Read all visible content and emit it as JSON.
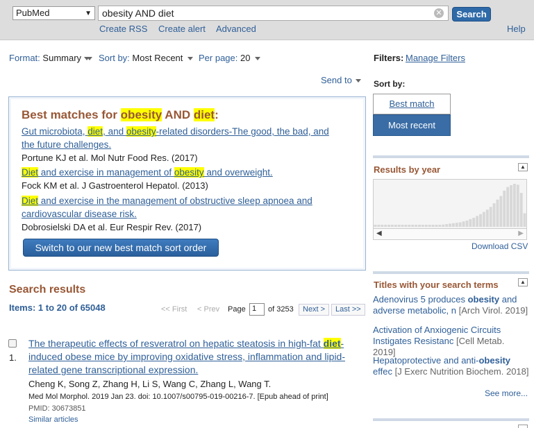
{
  "search": {
    "database": "PubMed",
    "query": "obesity AND diet",
    "button": "Search",
    "links": [
      "Create RSS",
      "Create alert",
      "Advanced"
    ],
    "help": "Help"
  },
  "toolbar": {
    "format_label": "Format:",
    "format_value": "Summary",
    "sort_label": "Sort by:",
    "sort_value": "Most Recent",
    "perpage_label": "Per page:",
    "perpage_value": "20",
    "send_to": "Send to"
  },
  "best": {
    "heading": [
      "Best matches for ",
      "obesity",
      " AND ",
      "diet",
      ":"
    ],
    "items": [
      {
        "line1": [
          "Gut microbiota, ",
          "diet",
          ", and ",
          "obesity",
          "-related disorders-The good, the bad, and"
        ],
        "line2": "the future challenges.",
        "cite": "Portune KJ et al. Mol Nutr Food Res. (2017)"
      },
      {
        "line1": [
          "Diet",
          " and exercise in management of ",
          "obesity",
          " and overweight."
        ],
        "cite": "Fock KM et al. J Gastroenterol Hepatol. (2013)"
      },
      {
        "line1": [
          "Diet",
          " and exercise in the management of obstructive sleep apnoea and"
        ],
        "line2": "cardiovascular disease risk.",
        "cite": "Dobrosielski DA et al. Eur Respir Rev. (2017)"
      }
    ],
    "switch_button": "Switch to our new best match sort order"
  },
  "results": {
    "heading": "Search results",
    "items_label": "Items: 1 to 20 of 65048",
    "first": "<< First",
    "prev": "< Prev",
    "page_label": "Page",
    "page_value": "1",
    "page_of": "of 3253",
    "next": "Next >",
    "last": "Last >>",
    "list": [
      {
        "num": "1.",
        "title1": [
          "The therapeutic effects of resveratrol on hepatic steatosis in high-fat ",
          "diet",
          "-"
        ],
        "title2": "induced obese mice by improving oxidative stress, inflammation and lipid-",
        "title3": "related gene transcriptional expression.",
        "authors": "Cheng K, Song Z, Zhang H, Li S, Wang C, Zhang L, Wang T.",
        "journal": "Med Mol Morphol. 2019 Jan 23. doi: 10.1007/s00795-019-00216-7. [Epub ahead of print]",
        "pmid": "PMID: 30673851",
        "similar": "Similar articles"
      }
    ]
  },
  "sidebar": {
    "filters_label": "Filters:",
    "manage_filters": "Manage Filters",
    "sortby_label": "Sort by:",
    "sort_options": [
      "Best match",
      "Most recent"
    ],
    "by_year": {
      "title": "Results by year",
      "counts": [
        3,
        3,
        3,
        3,
        3,
        3,
        3,
        3,
        3,
        3,
        3,
        3,
        3,
        3,
        3,
        3,
        3,
        4,
        4,
        4,
        5,
        6,
        7,
        8,
        9,
        10,
        12,
        14,
        17,
        20,
        24,
        28,
        33,
        38,
        44,
        52,
        60,
        68,
        80,
        88,
        92,
        95,
        93,
        75,
        30
      ],
      "download": "Download CSV"
    },
    "titles": {
      "header": "Titles with your search terms",
      "items": [
        {
          "text1": [
            "Adenovirus 5 produces ",
            "obesity",
            " and"
          ],
          "text2": "adverse metabolic, n",
          "source": "[Arch Virol. 2019]"
        },
        {
          "text1": [
            "Activation of Anxiogenic Circuits"
          ],
          "text2": "Instigates Resistanc",
          "source": "[Cell Metab. 2019]"
        },
        {
          "text1": [
            "Hepatoprotective and anti-",
            "obesity"
          ],
          "text2": "effec",
          "source": "[J Exerc Nutrition Biochem. 2018]"
        }
      ],
      "see_more": "See more..."
    }
  }
}
